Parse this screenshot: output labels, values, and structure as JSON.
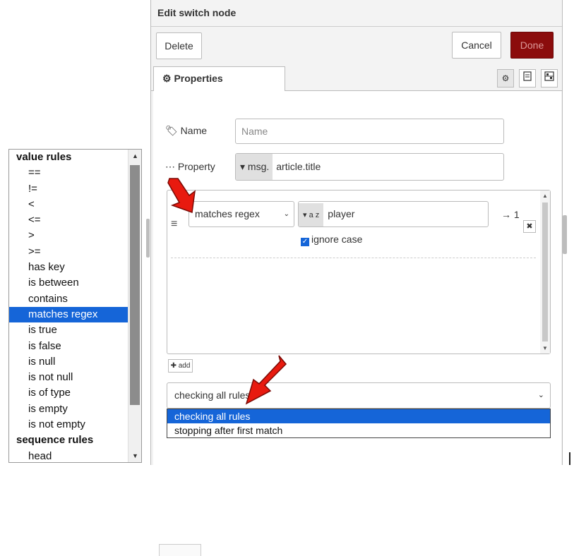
{
  "rule_list": {
    "items": [
      {
        "label": "value rules",
        "kind": "group"
      },
      {
        "label": "==",
        "kind": "item"
      },
      {
        "label": "!=",
        "kind": "item"
      },
      {
        "label": "<",
        "kind": "item"
      },
      {
        "label": "<=",
        "kind": "item"
      },
      {
        "label": ">",
        "kind": "item"
      },
      {
        "label": ">=",
        "kind": "item"
      },
      {
        "label": "has key",
        "kind": "item"
      },
      {
        "label": "is between",
        "kind": "item"
      },
      {
        "label": "contains",
        "kind": "item"
      },
      {
        "label": "matches regex",
        "kind": "item",
        "selected": true
      },
      {
        "label": "is true",
        "kind": "item"
      },
      {
        "label": "is false",
        "kind": "item"
      },
      {
        "label": "is null",
        "kind": "item"
      },
      {
        "label": "is not null",
        "kind": "item"
      },
      {
        "label": "is of type",
        "kind": "item"
      },
      {
        "label": "is empty",
        "kind": "item"
      },
      {
        "label": "is not empty",
        "kind": "item"
      },
      {
        "label": "sequence rules",
        "kind": "group"
      },
      {
        "label": "head",
        "kind": "item"
      }
    ]
  },
  "tray": {
    "title": "Edit switch node",
    "delete_label": "Delete",
    "cancel_label": "Cancel",
    "done_label": "Done",
    "tab_label": "Properties",
    "tab_icon": "gear-icon",
    "tab_icons": [
      "gear-icon",
      "description-icon",
      "appearance-icon"
    ]
  },
  "form": {
    "name_label": "Name",
    "name_placeholder": "Name",
    "property_label": "Property",
    "property_type": "msg.",
    "property_value": "article.title",
    "rule": {
      "operator": "matches regex",
      "value_type": "a z",
      "value": "player",
      "output": "→ 1",
      "ignore_case_label": "ignore case",
      "ignore_case_checked": true
    },
    "add_label": "add",
    "checking_value": "checking all rules",
    "checking_options": [
      "checking all rules",
      "stopping after first match"
    ]
  },
  "colors": {
    "highlight": "#1565d8",
    "done_button": "#8b0c0c",
    "arrow": "#e81a0f"
  }
}
